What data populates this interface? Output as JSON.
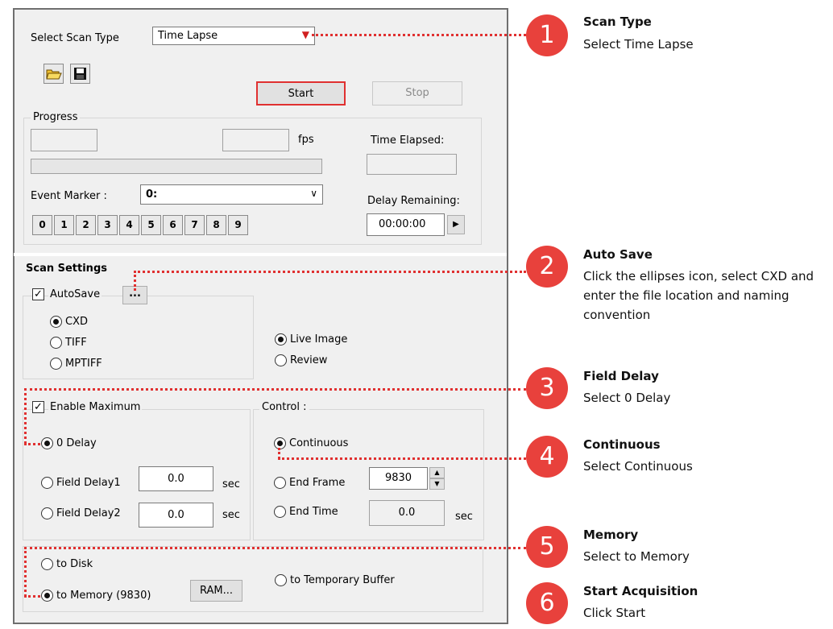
{
  "scan_type": {
    "label": "Select Scan Type",
    "value": "Time Lapse"
  },
  "toolbar": {
    "open_icon": "open-folder-icon",
    "save_icon": "floppy-save-icon"
  },
  "buttons": {
    "start": "Start",
    "stop": "Stop"
  },
  "progress": {
    "title": "Progress",
    "fps_label": "fps",
    "time_elapsed_label": "Time Elapsed:",
    "event_marker_label": "Event Marker :",
    "event_marker_value": "0:",
    "marker_buttons": [
      "0",
      "1",
      "2",
      "3",
      "4",
      "5",
      "6",
      "7",
      "8",
      "9"
    ],
    "delay_remaining_label": "Delay Remaining:",
    "delay_remaining_value": "00:00:00"
  },
  "scan_settings": {
    "title": "Scan Settings",
    "autosave_label": "AutoSave",
    "ellipsis": "...",
    "formats": [
      "CXD",
      "TIFF",
      "MPTIFF"
    ],
    "selected_format": "CXD",
    "views": [
      "Live Image",
      "Review"
    ],
    "selected_view": "Live Image"
  },
  "delay": {
    "enable_label": "Enable Maximum",
    "zero_delay": "0 Delay",
    "field_delay1": "Field Delay1",
    "field_delay1_value": "0.0",
    "field_delay2": "Field Delay2",
    "field_delay2_value": "0.0",
    "sec": "sec"
  },
  "control": {
    "title": "Control :",
    "continuous": "Continuous",
    "end_frame": "End Frame",
    "end_frame_value": "9830",
    "end_time": "End Time",
    "end_time_value": "0.0",
    "sec": "sec"
  },
  "memory": {
    "to_disk": "to Disk",
    "to_memory": "to Memory (9830)",
    "ram_button": "RAM...",
    "to_temp_buffer": "to Temporary Buffer"
  },
  "annotations": [
    {
      "num": "1",
      "title": "Scan Type",
      "desc": "Select Time Lapse"
    },
    {
      "num": "2",
      "title": "Auto Save",
      "desc": "Click the ellipses icon, select CXD and enter the file location and naming convention"
    },
    {
      "num": "3",
      "title": "Field Delay",
      "desc": "Select 0 Delay"
    },
    {
      "num": "4",
      "title": "Continuous",
      "desc": "Select Continuous"
    },
    {
      "num": "5",
      "title": "Memory",
      "desc": "Select to Memory"
    },
    {
      "num": "6",
      "title": "Start Acquisition",
      "desc": "Click Start"
    }
  ],
  "colors": {
    "accent": "#e8413c",
    "highlight_border": "#e03030",
    "panel_bg": "#f0f0f0"
  }
}
